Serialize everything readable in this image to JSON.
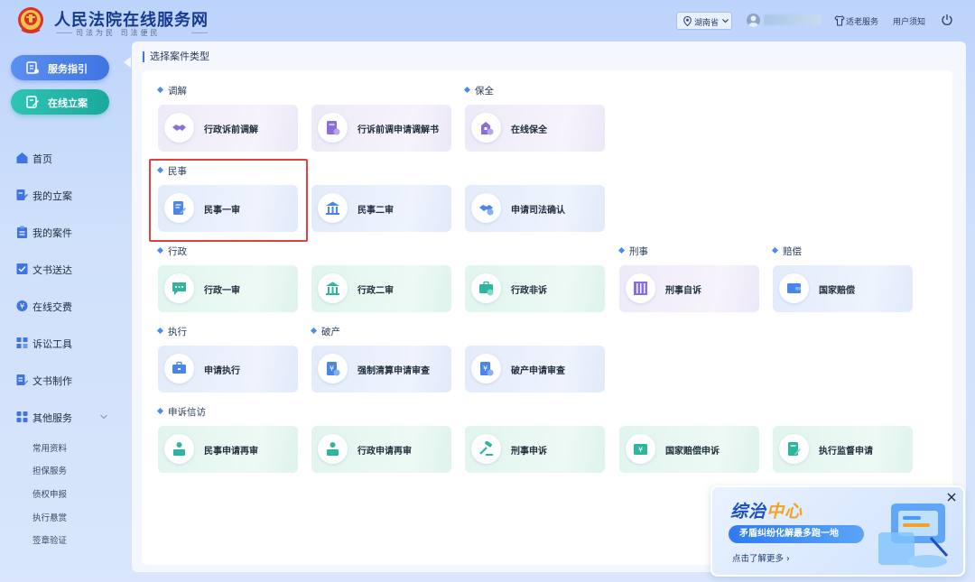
{
  "header": {
    "title": "人民法院在线服务网",
    "slogan": "司法为民  司法便民",
    "region": "湖南省",
    "links": {
      "elderly": "适老服务",
      "notice": "用户须知"
    }
  },
  "sidebar": {
    "guide_label": "服务指引",
    "file_label": "在线立案",
    "nav": [
      {
        "label": "首页"
      },
      {
        "label": "我的立案"
      },
      {
        "label": "我的案件"
      },
      {
        "label": "文书送达"
      },
      {
        "label": "在线交费"
      },
      {
        "label": "诉讼工具"
      },
      {
        "label": "文书制作"
      },
      {
        "label": "其他服务"
      }
    ],
    "sub": [
      "常用资料",
      "担保服务",
      "债权申报",
      "执行悬赏",
      "签章验证"
    ]
  },
  "main": {
    "section_title": "选择案件类型",
    "groups": {
      "mediation": "调解",
      "preservation": "保全",
      "civil": "民事",
      "admin": "行政",
      "criminal": "刑事",
      "compensation": "赔偿",
      "execution": "执行",
      "bankruptcy": "破产",
      "petition": "申诉信访"
    },
    "cards": {
      "admin_pre_mediation": "行政诉前调解",
      "pre_mediation_book": "行诉前调申请调解书",
      "online_preservation": "在线保全",
      "civil_first": "民事一审",
      "civil_second": "民事二审",
      "judicial_confirm": "申请司法确认",
      "admin_first": "行政一审",
      "admin_second": "行政二审",
      "admin_non_litigation": "行政非诉",
      "criminal_private": "刑事自诉",
      "state_compensation": "国家赔偿",
      "apply_execution": "申请执行",
      "forced_liquidation": "强制清算申请审查",
      "bankruptcy_review": "破产申请审查",
      "civil_retrial": "民事申请再审",
      "admin_retrial": "行政申请再审",
      "criminal_appeal": "刑事申诉",
      "state_comp_appeal": "国家赔偿申诉",
      "execution_supervision": "执行监督申请"
    }
  },
  "promo": {
    "title_part1": "综治",
    "title_part2": "中心",
    "subtitle": "矛盾纠纷化解最多跑一地",
    "more": "点击了解更多 ›"
  },
  "colors": {
    "primary": "#3f74e3",
    "teal": "#1aa99b",
    "highlight": "#e2413f",
    "accent_orange": "#f2a325"
  }
}
